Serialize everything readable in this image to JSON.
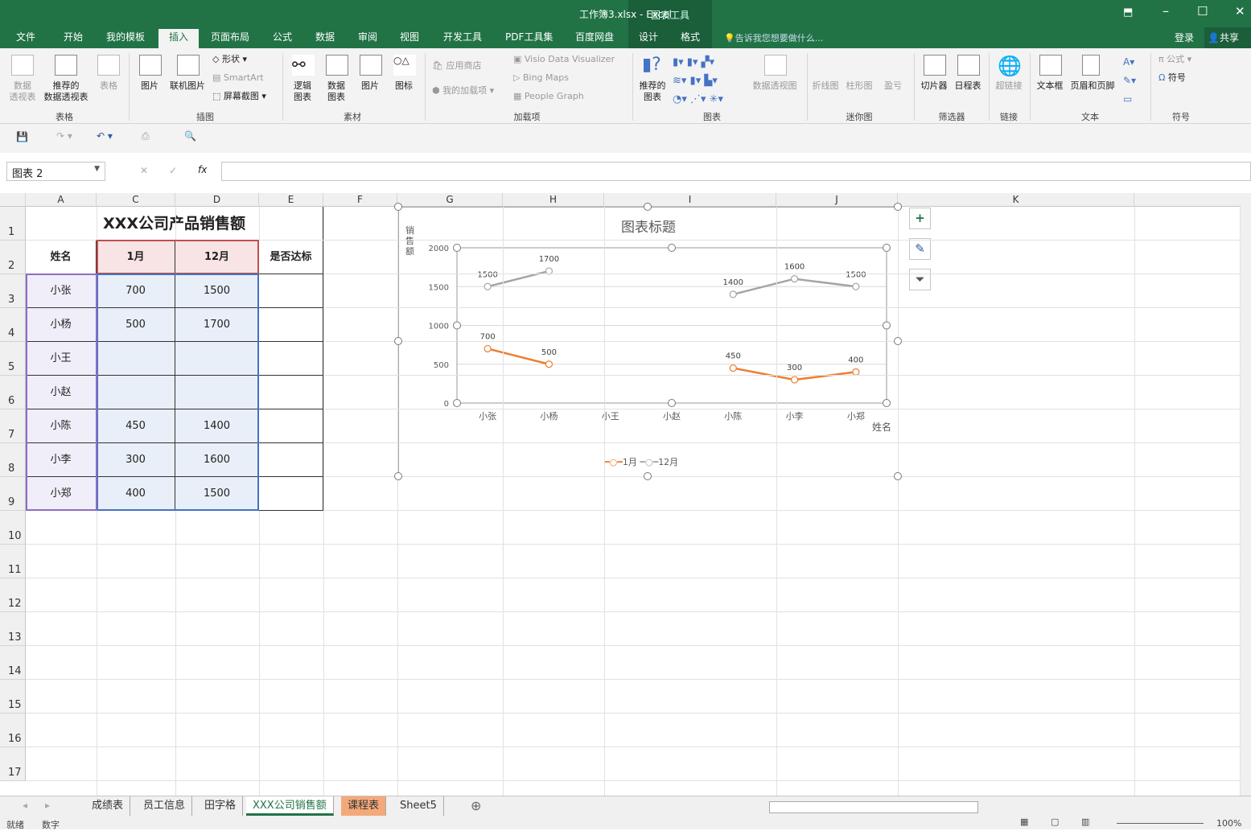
{
  "window": {
    "title": "工作簿3.xlsx - Excel",
    "chart_tools": "图表工具",
    "login": "登录",
    "share": "共享",
    "tell_me": "告诉我您想要做什么..."
  },
  "tabs": [
    "文件",
    "开始",
    "我的模板",
    "插入",
    "页面布局",
    "公式",
    "数据",
    "审阅",
    "视图",
    "开发工具",
    "PDF工具集",
    "百度网盘",
    "设计",
    "格式"
  ],
  "ribbon": {
    "table": {
      "items": [
        "数据\n透视表",
        "推荐的\n数据透视表",
        "表格"
      ],
      "label": "表格"
    },
    "illus": {
      "items": [
        "图片",
        "联机图片"
      ],
      "small": [
        "形状",
        "SmartArt",
        "屏幕截图"
      ],
      "label": "插图"
    },
    "material": {
      "items": [
        "逻辑\n图表",
        "数据\n图表",
        "图片",
        "图标"
      ],
      "label": "素材"
    },
    "addins": {
      "items": [
        "应用商店",
        "我的加载项",
        "Visio Data Visualizer",
        "Bing Maps",
        "People Graph"
      ],
      "label": "加载项"
    },
    "charts": {
      "items": [
        "推荐的\n图表",
        "数据透视图"
      ],
      "label": "图表"
    },
    "spark": {
      "items": [
        "折线图",
        "柱形图",
        "盈亏"
      ],
      "label": "迷你图"
    },
    "filter": {
      "items": [
        "切片器",
        "日程表"
      ],
      "label": "筛选器"
    },
    "link": {
      "items": [
        "超链接"
      ],
      "label": "链接"
    },
    "text": {
      "items": [
        "文本框",
        "页眉和页脚"
      ],
      "label": "文本"
    },
    "symbols": {
      "items": [
        "公式",
        "符号"
      ],
      "label": "符号"
    }
  },
  "namebox": "图表 2",
  "columns": [
    "A",
    "C",
    "D",
    "E",
    "F",
    "G",
    "H",
    "I",
    "J",
    "K"
  ],
  "rows": [
    "1",
    "2",
    "3",
    "4",
    "5",
    "6",
    "7",
    "8",
    "9",
    "10",
    "11",
    "12",
    "13",
    "14",
    "15",
    "16",
    "17"
  ],
  "table": {
    "title": "XXX公司产品销售额",
    "headers": [
      "姓名",
      "1月",
      "12月",
      "是否达标"
    ],
    "rows": [
      [
        "小张",
        "700",
        "1500",
        ""
      ],
      [
        "小杨",
        "500",
        "1700",
        ""
      ],
      [
        "小王",
        "",
        "",
        ""
      ],
      [
        "小赵",
        "",
        "",
        ""
      ],
      [
        "小陈",
        "450",
        "1400",
        ""
      ],
      [
        "小李",
        "300",
        "1600",
        ""
      ],
      [
        "小郑",
        "400",
        "1500",
        ""
      ]
    ]
  },
  "chart_data": {
    "type": "line",
    "title": "图表标题",
    "ylabel": "销售额",
    "xlabel": "姓名",
    "ylim": [
      0,
      2000
    ],
    "yticks": [
      "0",
      "500",
      "1000",
      "1500",
      "2000"
    ],
    "categories": [
      "小张",
      "小杨",
      "小王",
      "小赵",
      "小陈",
      "小李",
      "小郑"
    ],
    "series": [
      {
        "name": "1月",
        "color": "#ed7d31",
        "values": [
          700,
          500,
          null,
          null,
          450,
          300,
          400
        ]
      },
      {
        "name": "12月",
        "color": "#a5a5a5",
        "values": [
          1500,
          1700,
          null,
          null,
          1400,
          1600,
          1500
        ]
      }
    ],
    "legend": "bottom"
  },
  "sheets": [
    "成绩表",
    "员工信息",
    "田字格",
    "XXX公司销售额",
    "课程表",
    "Sheet5"
  ],
  "status": {
    "ready": "就绪",
    "num": "数字",
    "zoom": "100%"
  }
}
